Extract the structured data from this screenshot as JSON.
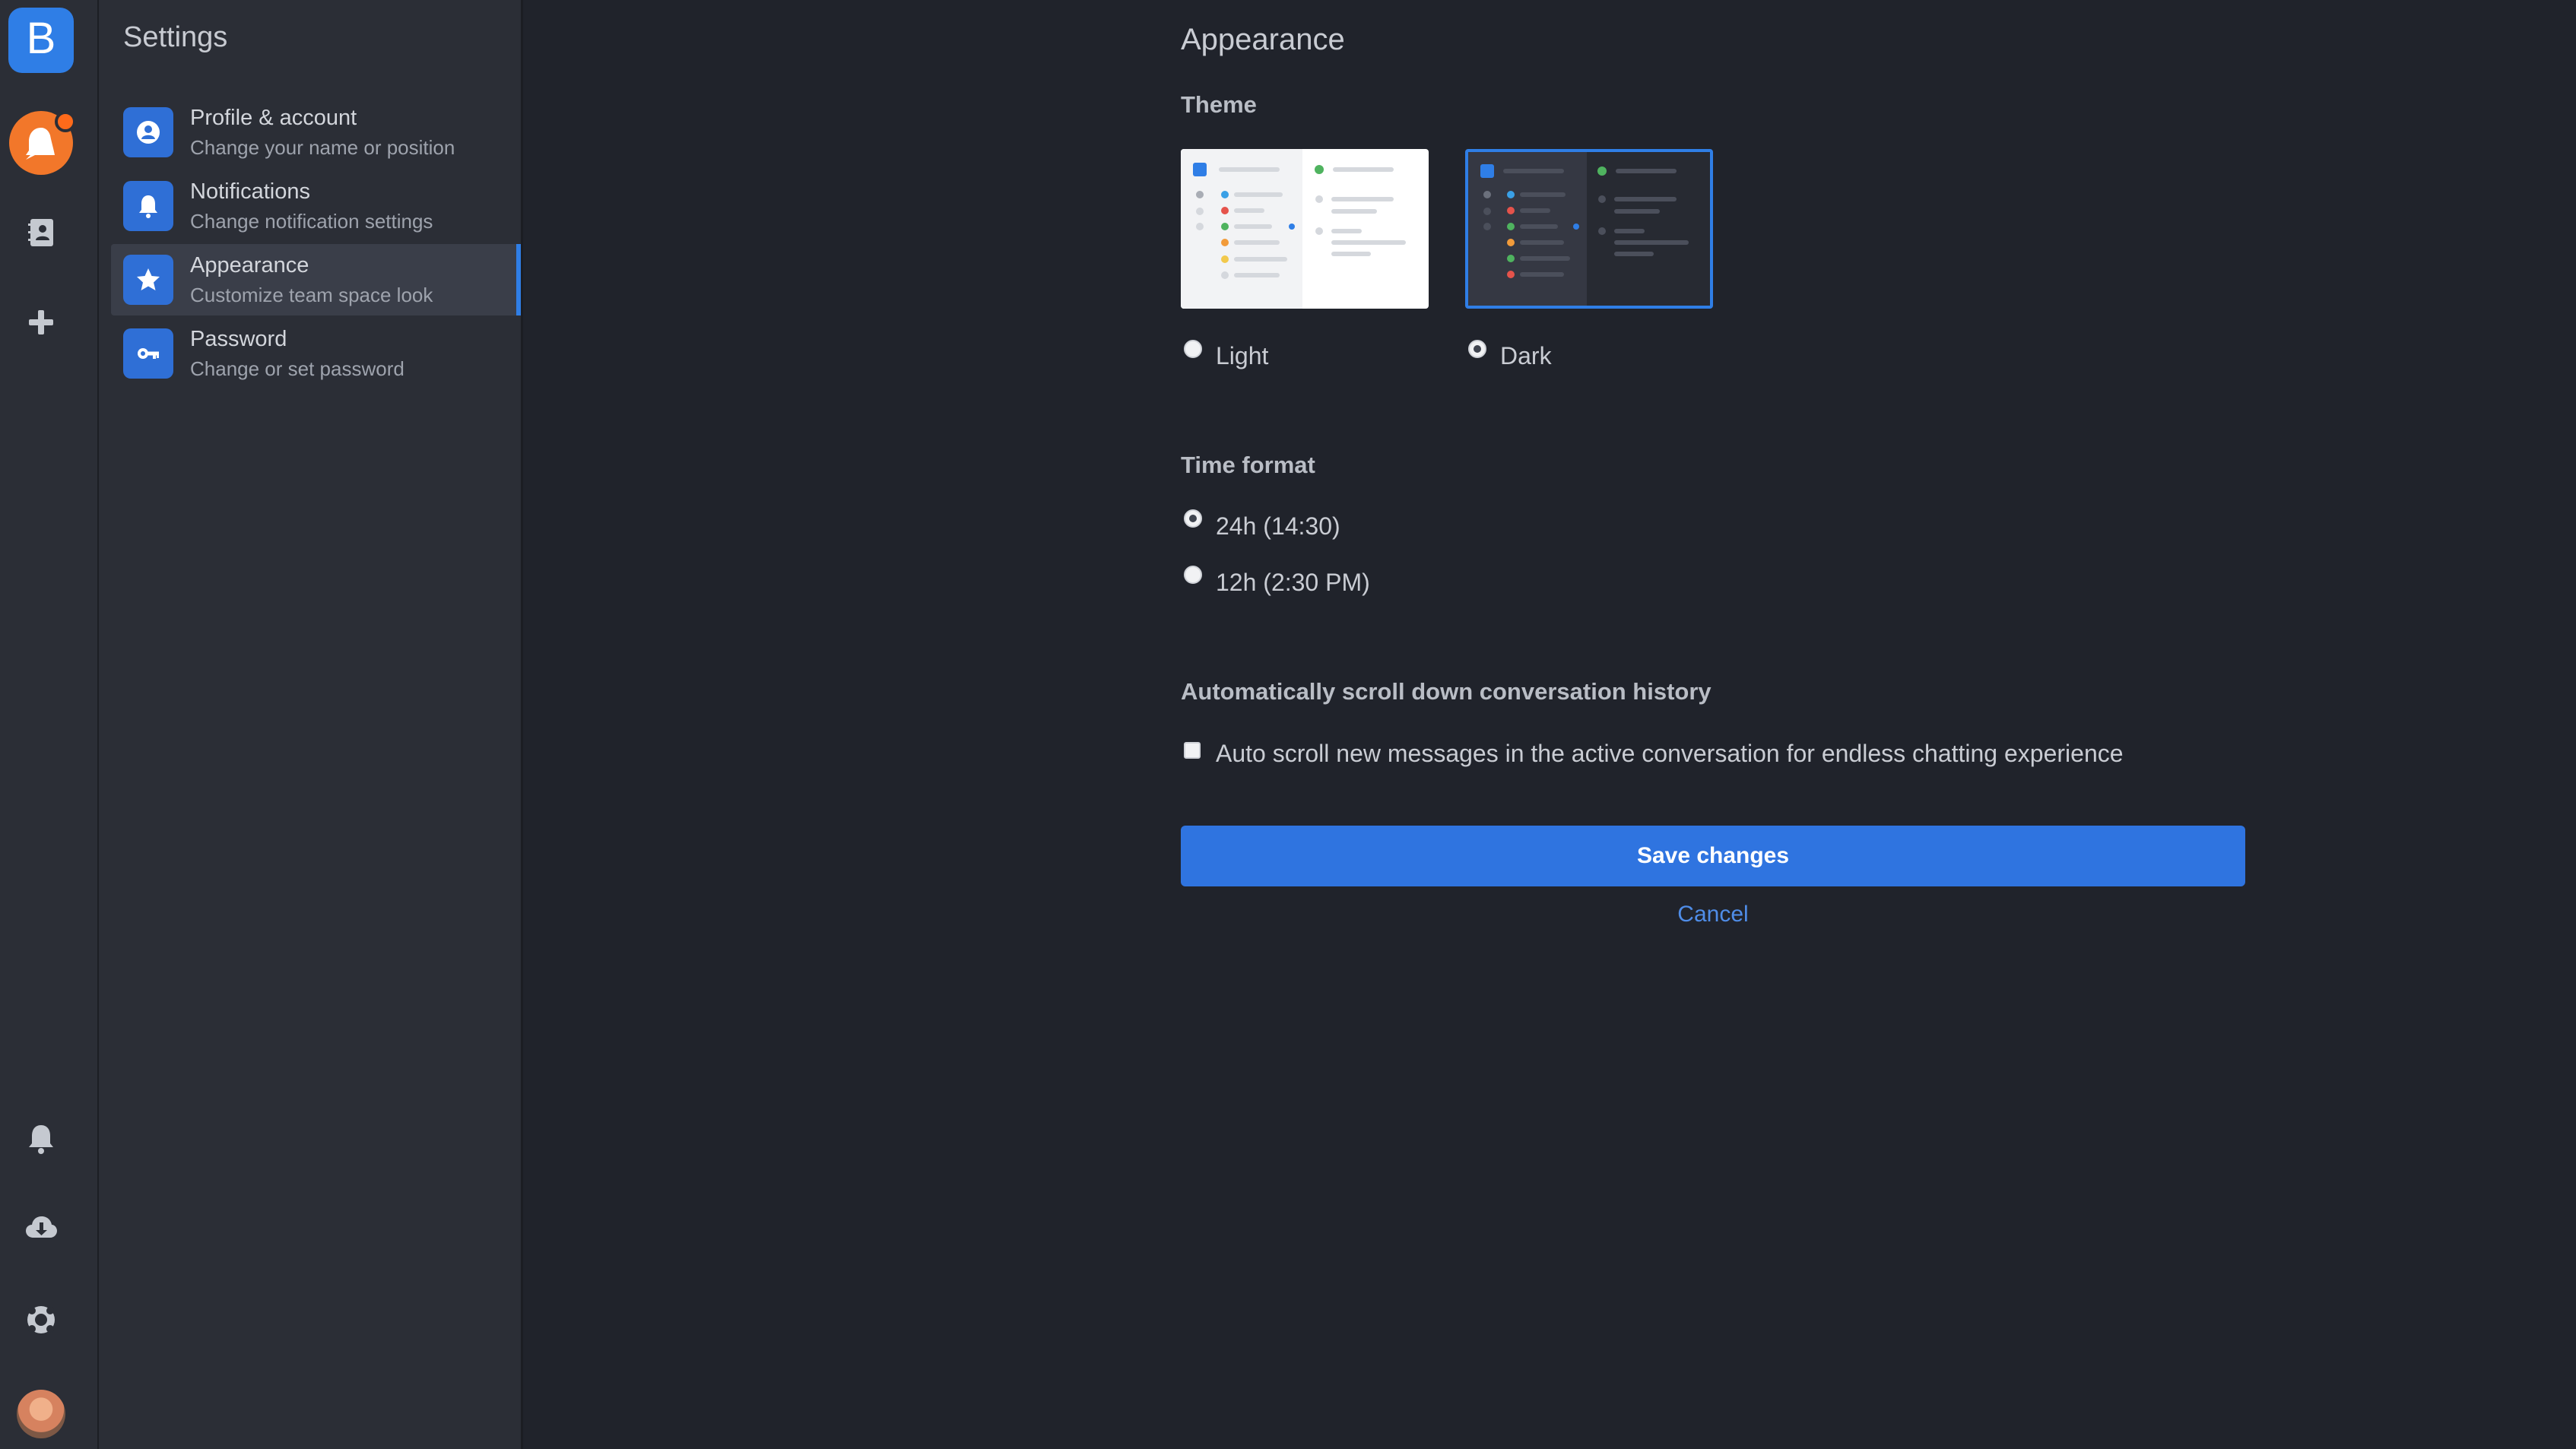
{
  "rail": {
    "logo_letter": "B",
    "icons": [
      "bot-icon",
      "contacts-icon",
      "plus-icon",
      "bell-icon",
      "cloud-download-icon",
      "lifebuoy-icon"
    ],
    "accent": "#2f7ee6",
    "bot_color": "#f2772a"
  },
  "sidebar": {
    "title": "Settings",
    "items": [
      {
        "label": "Profile & account",
        "sub": "Change your name or position",
        "icon": "user-icon",
        "active": false
      },
      {
        "label": "Notifications",
        "sub": "Change notification settings",
        "icon": "bell-icon",
        "active": false
      },
      {
        "label": "Appearance",
        "sub": "Customize team space look",
        "icon": "star-icon",
        "active": true
      },
      {
        "label": "Password",
        "sub": "Change or set password",
        "icon": "key-icon",
        "active": false
      }
    ]
  },
  "main": {
    "title": "Appearance",
    "theme": {
      "heading": "Theme",
      "options": [
        {
          "label": "Light",
          "checked": false
        },
        {
          "label": "Dark",
          "checked": true
        }
      ]
    },
    "time_format": {
      "heading": "Time format",
      "options": [
        {
          "label": "24h (14:30)",
          "checked": true
        },
        {
          "label": "12h (2:30 PM)",
          "checked": false
        }
      ]
    },
    "auto_scroll": {
      "heading": "Automatically scroll down conversation history",
      "checkbox_label": "Auto scroll new messages in the active conversation for endless chatting experience",
      "checked": false
    },
    "save_label": "Save changes",
    "cancel_label": "Cancel"
  },
  "colors": {
    "background": "#20232b",
    "panel": "#2b2e36",
    "primary": "#2f74e0",
    "link": "#4f8de8"
  }
}
